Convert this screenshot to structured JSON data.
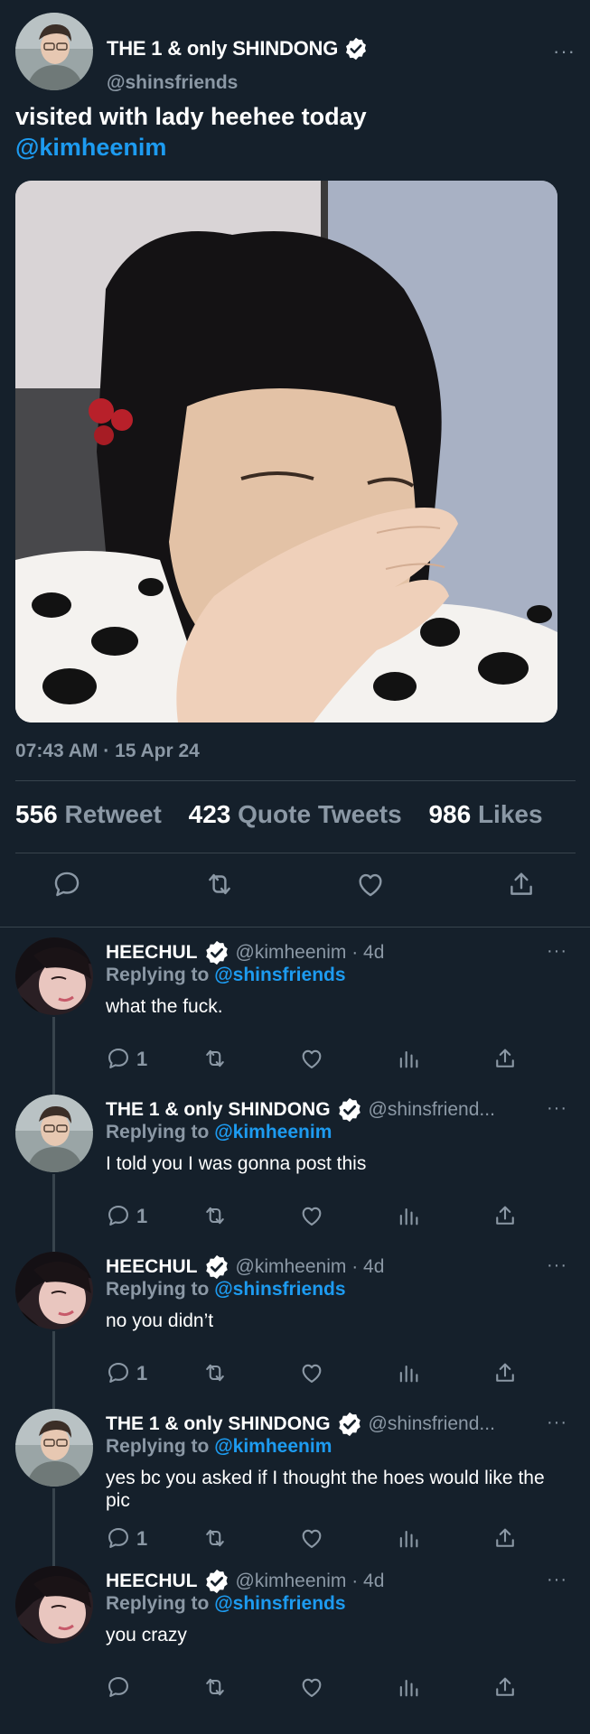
{
  "main_tweet": {
    "author_name": "THE 1 & only SHINDONG",
    "author_handle": "@shinsfriends",
    "text": "visited with lady heehee today",
    "mention": "@kimheenim",
    "timestamp": "07:43 AM · 15 Apr 24",
    "stats": {
      "retweets_count": "556",
      "retweets_label": "Retweet",
      "quotes_count": "423",
      "quotes_label": "Quote Tweets",
      "likes_count": "986",
      "likes_label": "Likes"
    },
    "more_label": "···",
    "actions": [
      "reply-icon",
      "retweet-icon",
      "like-icon",
      "share-icon"
    ]
  },
  "replies": [
    {
      "name": "HEECHUL",
      "handle": "@kimheenim · 4d",
      "replying_prefix": "Replying to",
      "replying_to": "@shinsfriends",
      "text": "what the fuck.",
      "reply_count": "1",
      "more_label": "···"
    },
    {
      "name": "THE 1 & only SHINDONG",
      "handle": "@shinsfriend...",
      "replying_prefix": "Replying to",
      "replying_to": "@kimheenim",
      "text": "I told you I was gonna post this",
      "reply_count": "1",
      "more_label": "···"
    },
    {
      "name": "HEECHUL",
      "handle": "@kimheenim · 4d",
      "replying_prefix": "Replying to",
      "replying_to": "@shinsfriends",
      "text": "no you didn’t",
      "reply_count": "1",
      "more_label": "···"
    },
    {
      "name": "THE 1 & only SHINDONG",
      "handle": "@shinsfriend...",
      "replying_prefix": "Replying to",
      "replying_to": "@kimheenim",
      "text": "yes bc you asked if I thought the hoes would like the pic",
      "reply_count": "1",
      "more_label": "···"
    },
    {
      "name": "HEECHUL",
      "handle": "@kimheenim · 4d",
      "replying_prefix": "Replying to",
      "replying_to": "@shinsfriends",
      "text": "you crazy",
      "reply_count": "",
      "more_label": "···"
    }
  ],
  "colors": {
    "background": "#15202b",
    "text": "#ffffff",
    "muted": "#8b98a5",
    "link": "#1d9bf0",
    "divider": "#38444d"
  }
}
